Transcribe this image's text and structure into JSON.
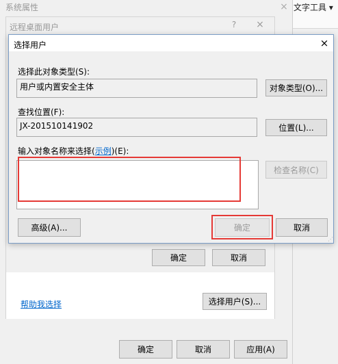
{
  "system_properties": {
    "title": "系统属性",
    "close": "×",
    "ok_label": "确定",
    "cancel_label": "取消",
    "apply_label": "应用(A)"
  },
  "background_app": {
    "ribbon_label": "文字工具 ▾"
  },
  "remote_desktop_users": {
    "title": "远程桌面用户",
    "help": "?",
    "close": "×",
    "ok_label": "确定",
    "cancel_label": "取消",
    "help_link": "帮助我选择",
    "select_users_label": "选择用户(S)..."
  },
  "select_users_dialog": {
    "title": "选择用户",
    "close": "×",
    "object_type_label": "选择此对象类型(S):",
    "object_type_value": "用户或内置安全主体",
    "object_types_button": "对象类型(O)...",
    "location_label": "查找位置(F):",
    "location_value": "JX-201510141902",
    "locations_button": "位置(L)...",
    "names_label_prefix": "输入对象名称来选择(",
    "names_label_link": "示例",
    "names_label_suffix": ")(E):",
    "names_value": "",
    "check_names_button": "检查名称(C)",
    "advanced_button": "高级(A)...",
    "ok_button": "确定",
    "cancel_button": "取消"
  },
  "colors": {
    "highlight": "#e53935",
    "link": "#0066cc",
    "disabled_text": "#9b9b9b"
  }
}
